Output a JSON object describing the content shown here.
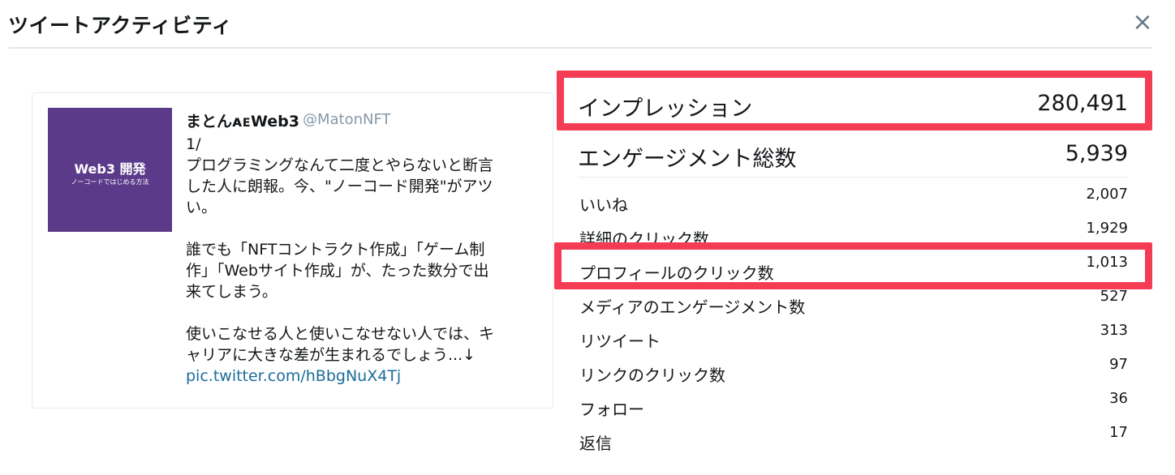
{
  "modal": {
    "title": "ツイートアクティビティ",
    "close_label": "×"
  },
  "tweet": {
    "author_name": "まとんᴀᴇWeb3",
    "handle": "@MatonNFT",
    "thumbnail_title": "Web3 開発",
    "thumbnail_subtitle": "ノーコードではじめる方法",
    "lines": [
      "1/",
      "プログラミングなんて二度とやらないと断言",
      "した人に朗報。今、\"ノーコード開発\"がアツ",
      "い。",
      "",
      "誰でも「NFTコントラクト作成」「ゲーム制",
      "作」「Webサイト作成」が、たった数分で出",
      "来てしまう。",
      "",
      "使いこなせる人と使いこなせない人では、キ",
      "ャリアに大きな差が生まれるでしょう...↓"
    ],
    "link": "pic.twitter.com/hBbgNuX4Tj"
  },
  "stats": {
    "impressions": {
      "label": "インプレッション",
      "value": "280,491"
    },
    "engagements": {
      "label": "エンゲージメント総数",
      "value": "5,939"
    },
    "rows": [
      {
        "label": "いいね",
        "value": "2,007"
      },
      {
        "label": "詳細のクリック数",
        "value": "1,929"
      },
      {
        "label": "プロフィールのクリック数",
        "value": "1,013"
      },
      {
        "label": "メディアのエンゲージメント数",
        "value": "527"
      },
      {
        "label": "リツイート",
        "value": "313"
      },
      {
        "label": "リンクのクリック数",
        "value": "97"
      },
      {
        "label": "フォロー",
        "value": "36"
      },
      {
        "label": "返信",
        "value": "17"
      }
    ]
  },
  "annotations": {
    "highlight_color": "#f43d55"
  }
}
